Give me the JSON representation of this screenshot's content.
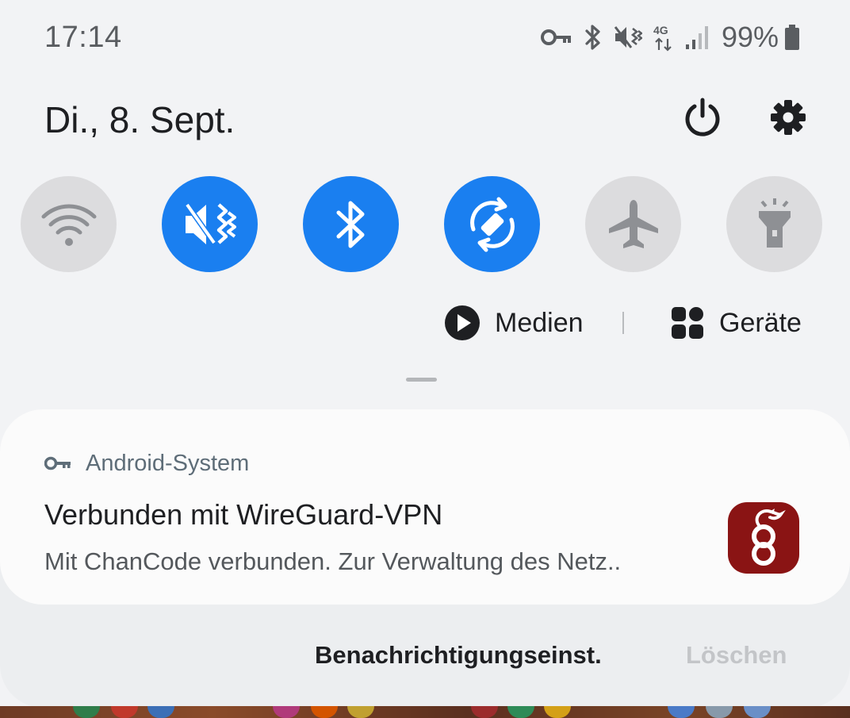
{
  "status_bar": {
    "time": "17:14",
    "icons": [
      "vpn-key-icon",
      "bluetooth-icon",
      "vibrate-mute-icon",
      "4g-data-icon",
      "signal-icon",
      "battery-icon"
    ],
    "network_type": "4G",
    "battery_percent": "99%"
  },
  "header": {
    "date": "Di., 8. Sept.",
    "power_icon": "power-icon",
    "settings_icon": "gear-icon"
  },
  "quick_settings": [
    {
      "name": "wifi",
      "icon": "wifi-icon",
      "active": false
    },
    {
      "name": "sound-mute-vibrate",
      "icon": "vibrate-mute-icon",
      "active": true
    },
    {
      "name": "bluetooth",
      "icon": "bluetooth-icon",
      "active": true
    },
    {
      "name": "auto-rotate",
      "icon": "rotate-icon",
      "active": true
    },
    {
      "name": "airplane-mode",
      "icon": "airplane-icon",
      "active": false
    },
    {
      "name": "flashlight",
      "icon": "flashlight-icon",
      "active": false
    }
  ],
  "media_row": {
    "media_label": "Medien",
    "devices_label": "Geräte"
  },
  "notification": {
    "app_name": "Android-System",
    "app_icon": "key-icon",
    "title": "Verbunden mit WireGuard-VPN",
    "body": "Mit ChanCode verbunden. Zur Verwaltung des Netz..",
    "large_icon": "wireguard-logo"
  },
  "actions": {
    "notification_settings": "Benachrichtigungseinst.",
    "clear": "Löschen"
  },
  "colors": {
    "accent": "#1a7ff0",
    "tile_off": "#dcdcde",
    "wireguard_red": "#8a1414"
  }
}
